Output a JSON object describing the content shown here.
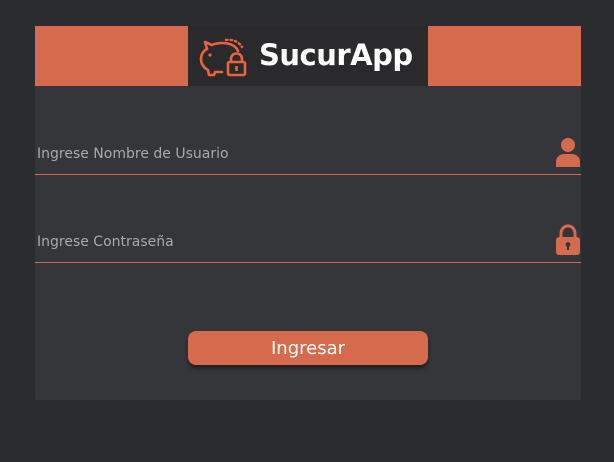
{
  "brand": {
    "name": "SucurApp",
    "logo_icon": "piggy-bank-lock-icon"
  },
  "colors": {
    "accent": "#d66a4c",
    "background": "#2b2c30",
    "card": "#35363a",
    "logo_background": "#2a2a2c"
  },
  "login": {
    "username": {
      "placeholder": "Ingrese Nombre de Usuario",
      "value": "",
      "icon": "user-icon"
    },
    "password": {
      "placeholder": "Ingrese Contraseña",
      "value": "",
      "icon": "lock-icon"
    },
    "submit_label": "Ingresar"
  }
}
